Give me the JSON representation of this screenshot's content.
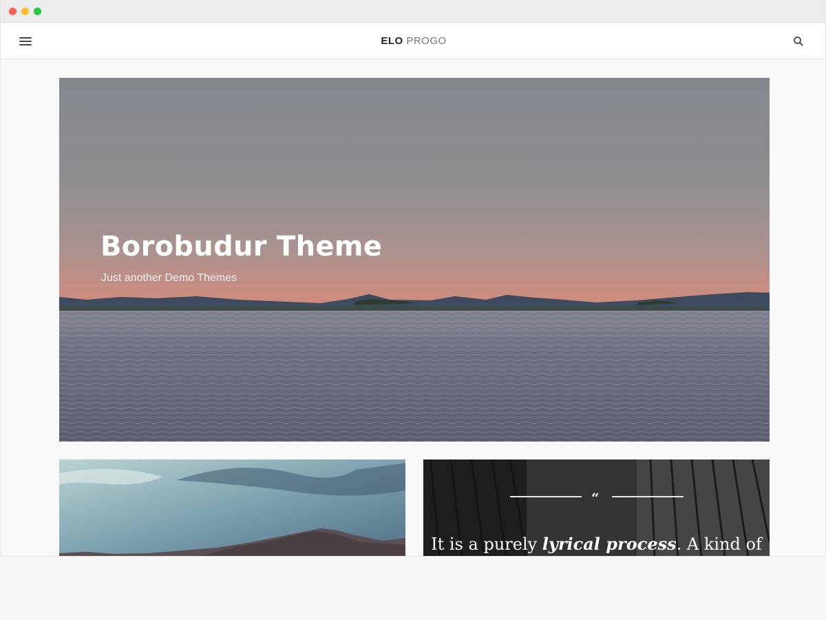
{
  "window": {
    "controls": [
      "close",
      "minimize",
      "zoom"
    ]
  },
  "header": {
    "logo_bold": "ELO",
    "logo_light": "PROGO",
    "menu_icon": "hamburger-menu-icon",
    "search_icon": "search-icon"
  },
  "hero": {
    "title": "Borobudur Theme",
    "subtitle": "Just another Demo Themes"
  },
  "cards": {
    "quote": {
      "mark": "“",
      "text_before": "It is a purely ",
      "text_emphasis": "lyrical process",
      "text_after": ". A kind of"
    }
  },
  "colors": {
    "header_bg": "#ffffff",
    "page_bg": "#f9f9f9",
    "hero_text": "#ffffff"
  }
}
